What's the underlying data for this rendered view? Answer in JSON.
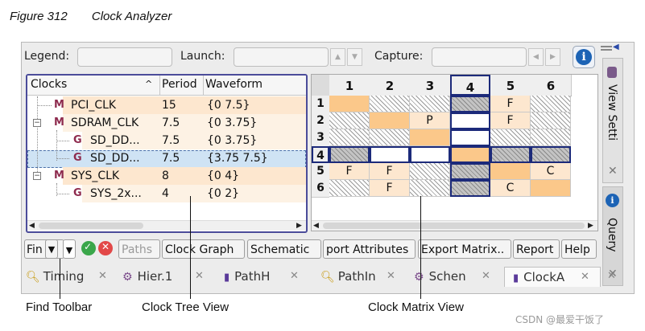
{
  "figure": {
    "number": "Figure 312",
    "title": "Clock Analyzer"
  },
  "legend_bar": {
    "legend_label": "Legend:",
    "launch_label": "Launch:",
    "capture_label": "Capture:",
    "legend_value": "",
    "launch_value": "",
    "capture_value": ""
  },
  "tree": {
    "columns": [
      "Clocks",
      "Period",
      "Waveform"
    ],
    "rows": [
      {
        "badge": "M",
        "name": "PCI_CLK",
        "period": "15",
        "waveform": "{0 7.5}",
        "level": 0
      },
      {
        "badge": "M",
        "name": "SDRAM_CLK",
        "period": "7.5",
        "waveform": "{0 3.75}",
        "level": 0
      },
      {
        "badge": "G",
        "name": "SD_DD...",
        "period": "7.5",
        "waveform": "{0 3.75}",
        "level": 1
      },
      {
        "badge": "G",
        "name": "SD_DD...",
        "period": "7.5",
        "waveform": "{3.75 7.5}",
        "level": 1
      },
      {
        "badge": "M",
        "name": "SYS_CLK",
        "period": "8",
        "waveform": "{0 4}",
        "level": 0
      },
      {
        "badge": "G",
        "name": "SYS_2x...",
        "period": "4",
        "waveform": "{0 2}",
        "level": 1
      }
    ]
  },
  "matrix": {
    "columns": [
      "1",
      "2",
      "3",
      "4",
      "5",
      "6"
    ],
    "rows": [
      "1",
      "2",
      "3",
      "4",
      "5",
      "6"
    ],
    "cells": [
      [
        "",
        "",
        "",
        "",
        "F",
        ""
      ],
      [
        "",
        "",
        "P",
        "",
        "F",
        ""
      ],
      [
        "",
        "",
        "",
        "",
        "",
        ""
      ],
      [
        "",
        "",
        "",
        "",
        "",
        ""
      ],
      [
        "F",
        "F",
        "",
        "",
        "",
        "C"
      ],
      [
        "",
        "F",
        "",
        "",
        "C",
        ""
      ]
    ]
  },
  "side_tabs": {
    "view_settings": "View Setti",
    "query": "Query"
  },
  "toolbar": {
    "find_label": "Fin",
    "buttons": [
      "Paths",
      "Clock Graph",
      "Schematic",
      "port Attributes",
      "Export Matrix..",
      "Report",
      "Help"
    ]
  },
  "bottom_tabs": [
    "Timing",
    "Hier.1",
    "PathH",
    "PathIn",
    "Schen",
    "ClockA"
  ],
  "captions": {
    "find_toolbar": "Find Toolbar",
    "clock_tree_view": "Clock Tree View",
    "clock_matrix_view": "Clock Matrix View"
  },
  "watermark": "CSDN @最爱干饭了",
  "colors": {
    "selection_border": "#1c2a7a",
    "matrix_orange": "#fbc88a",
    "tree_highlight": "#fde7cf",
    "tree_selected": "#cfe3f4",
    "badge": "#8e2b4e"
  }
}
